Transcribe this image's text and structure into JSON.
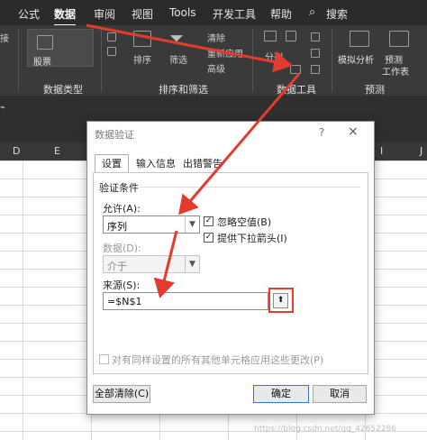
{
  "ribbon": {
    "tabs": [
      "公式",
      "数据",
      "审阅",
      "视图",
      "Tools",
      "开发工具",
      "帮助",
      "搜索"
    ],
    "active_tab": "数据",
    "groups": [
      "数据类型",
      "排序和筛选",
      "数据工具",
      "预测"
    ],
    "items": {
      "stocks": "股票",
      "sort": "排序",
      "filter": "筛选",
      "clear": "清除",
      "reapply": "重新应用",
      "advanced": "高级",
      "split": "分列",
      "whatif": "模拟分析",
      "forecast": "预测",
      "forecast_sheet": "工作表",
      "connections": "接"
    }
  },
  "sheet": {
    "columns": [
      "D",
      "E",
      "F",
      "I",
      "J"
    ]
  },
  "dialog": {
    "title": "数据验证",
    "help": "?",
    "close": "×",
    "tabs": [
      "设置",
      "输入信息",
      "出错警告"
    ],
    "section": "验证条件",
    "allow_label": "允许(A):",
    "allow_value": "序列",
    "ignore_blank": "忽略空值(B)",
    "dropdown": "提供下拉箭头(I)",
    "data_label": "数据(D):",
    "data_value": "介于",
    "source_label": "来源(S):",
    "source_value": "=$N$1",
    "apply_all": "对有同样设置的所有其他单元格应用这些更改(P)",
    "clear_all": "全部清除(C)",
    "ok": "确定",
    "cancel": "取消"
  },
  "watermark": "https://blog.csdn.net/qq_42652286",
  "colors": {
    "annotation": "#e33b2d",
    "ribbon_bg": "#3a3a3a",
    "tab_bg": "#2b2b2b"
  }
}
